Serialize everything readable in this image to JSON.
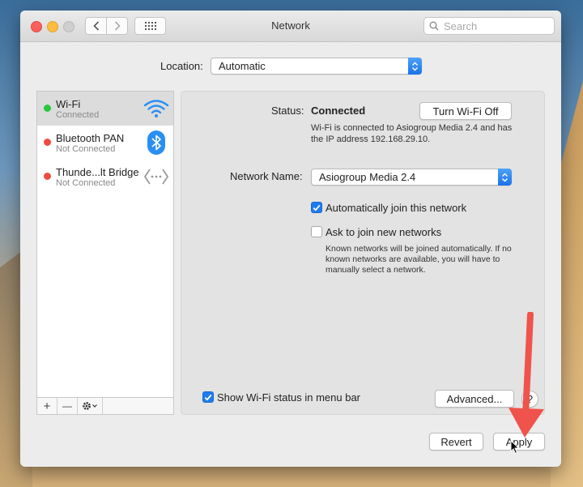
{
  "window": {
    "title": "Network"
  },
  "search": {
    "placeholder": "Search"
  },
  "location": {
    "label": "Location:",
    "value": "Automatic"
  },
  "services": [
    {
      "name": "Wi-Fi",
      "status": "Connected",
      "indicator": "#28c840",
      "icon": "wifi-icon"
    },
    {
      "name": "Bluetooth PAN",
      "status": "Not Connected",
      "indicator": "#ee4b43",
      "icon": "bluetooth-icon"
    },
    {
      "name": "Thunde...lt Bridge",
      "status": "Not Connected",
      "indicator": "#ee4b43",
      "icon": "thunderbolt-bridge-icon"
    }
  ],
  "sidebar_toolbar": {
    "add": "+",
    "remove": "—"
  },
  "status": {
    "label": "Status:",
    "value": "Connected",
    "description": "Wi-Fi is connected to Asiogroup Media 2.4 and has the IP address 192.168.29.10.",
    "toggle_button": "Turn Wi-Fi Off"
  },
  "network_name": {
    "label": "Network Name:",
    "value": "Asiogroup Media 2.4"
  },
  "options": {
    "auto_join": {
      "label": "Automatically join this network",
      "checked": true
    },
    "ask_join": {
      "label": "Ask to join new networks",
      "checked": false,
      "description": "Known networks will be joined automatically. If no known networks are available, you will have to manually select a network."
    },
    "show_status": {
      "label": "Show Wi-Fi status in menu bar",
      "checked": true
    }
  },
  "buttons": {
    "advanced": "Advanced...",
    "help": "?",
    "revert": "Revert",
    "apply": "Apply"
  },
  "colors": {
    "accent": "#1f7bf0",
    "connected": "#28c840",
    "disconnected": "#ee4b43",
    "annotation_arrow": "#f0534b"
  }
}
